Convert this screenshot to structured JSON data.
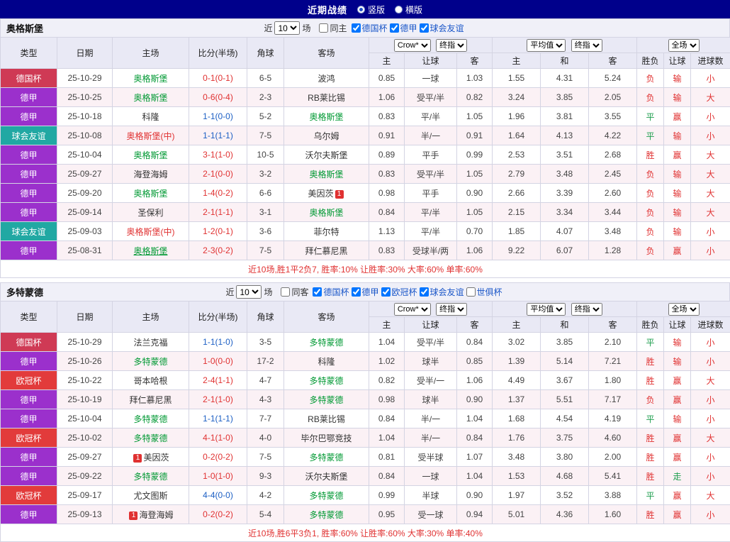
{
  "title_bar": {
    "title": "近期战绩",
    "options": [
      {
        "label": "竖版",
        "selected": true
      },
      {
        "label": "横版",
        "selected": false
      }
    ]
  },
  "table_header": {
    "type": "类型",
    "date": "日期",
    "home": "主场",
    "score": "比分(半场)",
    "corner": "角球",
    "away": "客场",
    "odds_source": "Crow*",
    "odds_stage": "终指",
    "avg_source": "平均值",
    "avg_stage": "终指",
    "scope": "全场",
    "sub_home": "主",
    "sub_handicap": "让球",
    "sub_away": "客",
    "sub_avg_home": "主",
    "sub_draw": "和",
    "sub_avg_away": "客",
    "sub_result": "胜负",
    "sub_handicap_result": "让球",
    "sub_goals": "进球数"
  },
  "type_colors": {
    "德国杯": "#cf3a55",
    "德甲": "#9b30cc",
    "球会友谊": "#21a8a3",
    "欧冠杯": "#e23b3b"
  },
  "colors": {
    "win_red": "#e03131",
    "draw_green": "#1e9e4e",
    "score_draw_blue": "#1c5fc4",
    "subject_green": "#009933",
    "navy": "#00008b"
  },
  "sections": [
    {
      "team": "奥格斯堡",
      "filter": {
        "near_label": "近",
        "count": "10",
        "unit_label": "场",
        "venue": {
          "label": "同主",
          "checked": false
        },
        "competitions": [
          {
            "label": "德国杯",
            "checked": true
          },
          {
            "label": "德甲",
            "checked": true
          },
          {
            "label": "球会友谊",
            "checked": true
          }
        ]
      },
      "rows": [
        {
          "type": "德国杯",
          "date": "25-10-29",
          "home": {
            "name": "奥格斯堡",
            "style": "subject"
          },
          "score": {
            "text": "0-1(0-1)",
            "color": "#e03131"
          },
          "corner": "6-5",
          "away": {
            "name": "波鸿",
            "style": "normal"
          },
          "odds": [
            "0.85",
            "一球",
            "1.03",
            "1.55",
            "4.31",
            "5.24"
          ],
          "results": [
            {
              "text": "负",
              "color": "#e03131"
            },
            {
              "text": "输",
              "color": "#e03131"
            },
            {
              "text": "小",
              "color": "#e03131"
            }
          ]
        },
        {
          "type": "德甲",
          "date": "25-10-25",
          "home": {
            "name": "奥格斯堡",
            "style": "subject"
          },
          "score": {
            "text": "0-6(0-4)",
            "color": "#e03131"
          },
          "corner": "2-3",
          "away": {
            "name": "RB莱比锡",
            "style": "normal"
          },
          "odds": [
            "1.06",
            "受平/半",
            "0.82",
            "3.24",
            "3.85",
            "2.05"
          ],
          "results": [
            {
              "text": "负",
              "color": "#e03131"
            },
            {
              "text": "输",
              "color": "#e03131"
            },
            {
              "text": "大",
              "color": "#e03131"
            }
          ]
        },
        {
          "type": "德甲",
          "date": "25-10-18",
          "home": {
            "name": "科隆",
            "style": "normal"
          },
          "score": {
            "text": "1-1(0-0)",
            "color": "#1c5fc4"
          },
          "corner": "5-2",
          "away": {
            "name": "奥格斯堡",
            "style": "subject"
          },
          "odds": [
            "0.83",
            "平/半",
            "1.05",
            "1.96",
            "3.81",
            "3.55"
          ],
          "results": [
            {
              "text": "平",
              "color": "#1e9e4e"
            },
            {
              "text": "赢",
              "color": "#e03131"
            },
            {
              "text": "小",
              "color": "#e03131"
            }
          ]
        },
        {
          "type": "球会友谊",
          "date": "25-10-08",
          "home": {
            "name": "奥格斯堡(中)",
            "style": "neutral"
          },
          "score": {
            "text": "1-1(1-1)",
            "color": "#1c5fc4"
          },
          "corner": "7-5",
          "away": {
            "name": "乌尔姆",
            "style": "normal"
          },
          "odds": [
            "0.91",
            "半/一",
            "0.91",
            "1.64",
            "4.13",
            "4.22"
          ],
          "results": [
            {
              "text": "平",
              "color": "#1e9e4e"
            },
            {
              "text": "输",
              "color": "#e03131"
            },
            {
              "text": "小",
              "color": "#e03131"
            }
          ]
        },
        {
          "type": "德甲",
          "date": "25-10-04",
          "home": {
            "name": "奥格斯堡",
            "style": "subject"
          },
          "score": {
            "text": "3-1(1-0)",
            "color": "#e03131"
          },
          "corner": "10-5",
          "away": {
            "name": "沃尔夫斯堡",
            "style": "normal"
          },
          "odds": [
            "0.89",
            "平手",
            "0.99",
            "2.53",
            "3.51",
            "2.68"
          ],
          "results": [
            {
              "text": "胜",
              "color": "#e03131"
            },
            {
              "text": "赢",
              "color": "#e03131"
            },
            {
              "text": "大",
              "color": "#e03131"
            }
          ]
        },
        {
          "type": "德甲",
          "date": "25-09-27",
          "home": {
            "name": "海登海姆",
            "style": "normal"
          },
          "score": {
            "text": "2-1(0-0)",
            "color": "#e03131"
          },
          "corner": "3-2",
          "away": {
            "name": "奥格斯堡",
            "style": "subject"
          },
          "odds": [
            "0.83",
            "受平/半",
            "1.05",
            "2.79",
            "3.48",
            "2.45"
          ],
          "results": [
            {
              "text": "负",
              "color": "#e03131"
            },
            {
              "text": "输",
              "color": "#e03131"
            },
            {
              "text": "大",
              "color": "#e03131"
            }
          ]
        },
        {
          "type": "德甲",
          "date": "25-09-20",
          "home": {
            "name": "奥格斯堡",
            "style": "subject"
          },
          "score": {
            "text": "1-4(0-2)",
            "color": "#e03131"
          },
          "corner": "6-6",
          "away": {
            "name": "美因茨",
            "style": "normal",
            "badge_after": "1"
          },
          "odds": [
            "0.98",
            "平手",
            "0.90",
            "2.66",
            "3.39",
            "2.60"
          ],
          "results": [
            {
              "text": "负",
              "color": "#e03131"
            },
            {
              "text": "输",
              "color": "#e03131"
            },
            {
              "text": "大",
              "color": "#e03131"
            }
          ]
        },
        {
          "type": "德甲",
          "date": "25-09-14",
          "home": {
            "name": "圣保利",
            "style": "normal"
          },
          "score": {
            "text": "2-1(1-1)",
            "color": "#e03131"
          },
          "corner": "3-1",
          "away": {
            "name": "奥格斯堡",
            "style": "subject"
          },
          "odds": [
            "0.84",
            "平/半",
            "1.05",
            "2.15",
            "3.34",
            "3.44"
          ],
          "results": [
            {
              "text": "负",
              "color": "#e03131"
            },
            {
              "text": "输",
              "color": "#e03131"
            },
            {
              "text": "大",
              "color": "#e03131"
            }
          ]
        },
        {
          "type": "球会友谊",
          "date": "25-09-03",
          "home": {
            "name": "奥格斯堡(中)",
            "style": "neutral"
          },
          "score": {
            "text": "1-2(0-1)",
            "color": "#e03131"
          },
          "corner": "3-6",
          "away": {
            "name": "菲尔特",
            "style": "normal"
          },
          "odds": [
            "1.13",
            "平/半",
            "0.70",
            "1.85",
            "4.07",
            "3.48"
          ],
          "results": [
            {
              "text": "负",
              "color": "#e03131"
            },
            {
              "text": "输",
              "color": "#e03131"
            },
            {
              "text": "小",
              "color": "#e03131"
            }
          ]
        },
        {
          "type": "德甲",
          "date": "25-08-31",
          "home": {
            "name": "奥格斯堡",
            "style": "subject_underline"
          },
          "score": {
            "text": "2-3(0-2)",
            "color": "#e03131"
          },
          "corner": "7-5",
          "away": {
            "name": "拜仁慕尼黑",
            "style": "normal"
          },
          "odds": [
            "0.83",
            "受球半/两",
            "1.06",
            "9.22",
            "6.07",
            "1.28"
          ],
          "results": [
            {
              "text": "负",
              "color": "#e03131"
            },
            {
              "text": "赢",
              "color": "#e03131"
            },
            {
              "text": "小",
              "color": "#e03131"
            }
          ]
        }
      ],
      "summary": "近10场,胜1平2负7, 胜率:10% 让胜率:30% 大率:60% 单率:60%"
    },
    {
      "team": "多特蒙德",
      "filter": {
        "near_label": "近",
        "count": "10",
        "unit_label": "场",
        "venue": {
          "label": "同客",
          "checked": false
        },
        "competitions": [
          {
            "label": "德国杯",
            "checked": true
          },
          {
            "label": "德甲",
            "checked": true
          },
          {
            "label": "欧冠杯",
            "checked": true
          },
          {
            "label": "球会友谊",
            "checked": true
          },
          {
            "label": "世俱杯",
            "checked": false
          }
        ]
      },
      "rows": [
        {
          "type": "德国杯",
          "date": "25-10-29",
          "home": {
            "name": "法兰克福",
            "style": "normal"
          },
          "score": {
            "text": "1-1(1-0)",
            "color": "#1c5fc4"
          },
          "corner": "3-5",
          "away": {
            "name": "多特蒙德",
            "style": "subject"
          },
          "odds": [
            "1.04",
            "受平/半",
            "0.84",
            "3.02",
            "3.85",
            "2.10"
          ],
          "results": [
            {
              "text": "平",
              "color": "#1e9e4e"
            },
            {
              "text": "输",
              "color": "#e03131"
            },
            {
              "text": "小",
              "color": "#e03131"
            }
          ]
        },
        {
          "type": "德甲",
          "date": "25-10-26",
          "home": {
            "name": "多特蒙德",
            "style": "subject"
          },
          "score": {
            "text": "1-0(0-0)",
            "color": "#e03131"
          },
          "corner": "17-2",
          "away": {
            "name": "科隆",
            "style": "normal"
          },
          "odds": [
            "1.02",
            "球半",
            "0.85",
            "1.39",
            "5.14",
            "7.21"
          ],
          "results": [
            {
              "text": "胜",
              "color": "#e03131"
            },
            {
              "text": "输",
              "color": "#e03131"
            },
            {
              "text": "小",
              "color": "#e03131"
            }
          ]
        },
        {
          "type": "欧冠杯",
          "date": "25-10-22",
          "home": {
            "name": "哥本哈根",
            "style": "normal"
          },
          "score": {
            "text": "2-4(1-1)",
            "color": "#e03131"
          },
          "corner": "4-7",
          "away": {
            "name": "多特蒙德",
            "style": "subject"
          },
          "odds": [
            "0.82",
            "受半/一",
            "1.06",
            "4.49",
            "3.67",
            "1.80"
          ],
          "results": [
            {
              "text": "胜",
              "color": "#e03131"
            },
            {
              "text": "赢",
              "color": "#e03131"
            },
            {
              "text": "大",
              "color": "#e03131"
            }
          ]
        },
        {
          "type": "德甲",
          "date": "25-10-19",
          "home": {
            "name": "拜仁慕尼黑",
            "style": "normal"
          },
          "score": {
            "text": "2-1(1-0)",
            "color": "#e03131"
          },
          "corner": "4-3",
          "away": {
            "name": "多特蒙德",
            "style": "subject"
          },
          "odds": [
            "0.98",
            "球半",
            "0.90",
            "1.37",
            "5.51",
            "7.17"
          ],
          "results": [
            {
              "text": "负",
              "color": "#e03131"
            },
            {
              "text": "赢",
              "color": "#e03131"
            },
            {
              "text": "小",
              "color": "#e03131"
            }
          ]
        },
        {
          "type": "德甲",
          "date": "25-10-04",
          "home": {
            "name": "多特蒙德",
            "style": "subject"
          },
          "score": {
            "text": "1-1(1-1)",
            "color": "#1c5fc4"
          },
          "corner": "7-7",
          "away": {
            "name": "RB莱比锡",
            "style": "normal"
          },
          "odds": [
            "0.84",
            "半/一",
            "1.04",
            "1.68",
            "4.54",
            "4.19"
          ],
          "results": [
            {
              "text": "平",
              "color": "#1e9e4e"
            },
            {
              "text": "输",
              "color": "#e03131"
            },
            {
              "text": "小",
              "color": "#e03131"
            }
          ]
        },
        {
          "type": "欧冠杯",
          "date": "25-10-02",
          "home": {
            "name": "多特蒙德",
            "style": "subject"
          },
          "score": {
            "text": "4-1(1-0)",
            "color": "#e03131"
          },
          "corner": "4-0",
          "away": {
            "name": "毕尔巴鄂竞技",
            "style": "normal"
          },
          "odds": [
            "1.04",
            "半/一",
            "0.84",
            "1.76",
            "3.75",
            "4.60"
          ],
          "results": [
            {
              "text": "胜",
              "color": "#e03131"
            },
            {
              "text": "赢",
              "color": "#e03131"
            },
            {
              "text": "大",
              "color": "#e03131"
            }
          ]
        },
        {
          "type": "德甲",
          "date": "25-09-27",
          "home": {
            "name": "美因茨",
            "style": "normal",
            "badge_before": "1"
          },
          "score": {
            "text": "0-2(0-2)",
            "color": "#e03131"
          },
          "corner": "7-5",
          "away": {
            "name": "多特蒙德",
            "style": "subject"
          },
          "odds": [
            "0.81",
            "受半球",
            "1.07",
            "3.48",
            "3.80",
            "2.00"
          ],
          "results": [
            {
              "text": "胜",
              "color": "#e03131"
            },
            {
              "text": "赢",
              "color": "#e03131"
            },
            {
              "text": "小",
              "color": "#e03131"
            }
          ]
        },
        {
          "type": "德甲",
          "date": "25-09-22",
          "home": {
            "name": "多特蒙德",
            "style": "subject"
          },
          "score": {
            "text": "1-0(1-0)",
            "color": "#e03131"
          },
          "corner": "9-3",
          "away": {
            "name": "沃尔夫斯堡",
            "style": "normal"
          },
          "odds": [
            "0.84",
            "一球",
            "1.04",
            "1.53",
            "4.68",
            "5.41"
          ],
          "results": [
            {
              "text": "胜",
              "color": "#e03131"
            },
            {
              "text": "走",
              "color": "#1e9e4e"
            },
            {
              "text": "小",
              "color": "#e03131"
            }
          ]
        },
        {
          "type": "欧冠杯",
          "date": "25-09-17",
          "home": {
            "name": "尤文图斯",
            "style": "normal"
          },
          "score": {
            "text": "4-4(0-0)",
            "color": "#1c5fc4"
          },
          "corner": "4-2",
          "away": {
            "name": "多特蒙德",
            "style": "subject"
          },
          "odds": [
            "0.99",
            "半球",
            "0.90",
            "1.97",
            "3.52",
            "3.88"
          ],
          "results": [
            {
              "text": "平",
              "color": "#1e9e4e"
            },
            {
              "text": "赢",
              "color": "#e03131"
            },
            {
              "text": "大",
              "color": "#e03131"
            }
          ]
        },
        {
          "type": "德甲",
          "date": "25-09-13",
          "home": {
            "name": "海登海姆",
            "style": "normal",
            "badge_before": "1"
          },
          "score": {
            "text": "0-2(0-2)",
            "color": "#e03131"
          },
          "corner": "5-4",
          "away": {
            "name": "多特蒙德",
            "style": "subject"
          },
          "odds": [
            "0.95",
            "受一球",
            "0.94",
            "5.01",
            "4.36",
            "1.60"
          ],
          "results": [
            {
              "text": "胜",
              "color": "#e03131"
            },
            {
              "text": "赢",
              "color": "#e03131"
            },
            {
              "text": "小",
              "color": "#e03131"
            }
          ]
        }
      ],
      "summary": "近10场,胜6平3负1, 胜率:60% 让胜率:60% 大率:30% 单率:40%"
    }
  ]
}
